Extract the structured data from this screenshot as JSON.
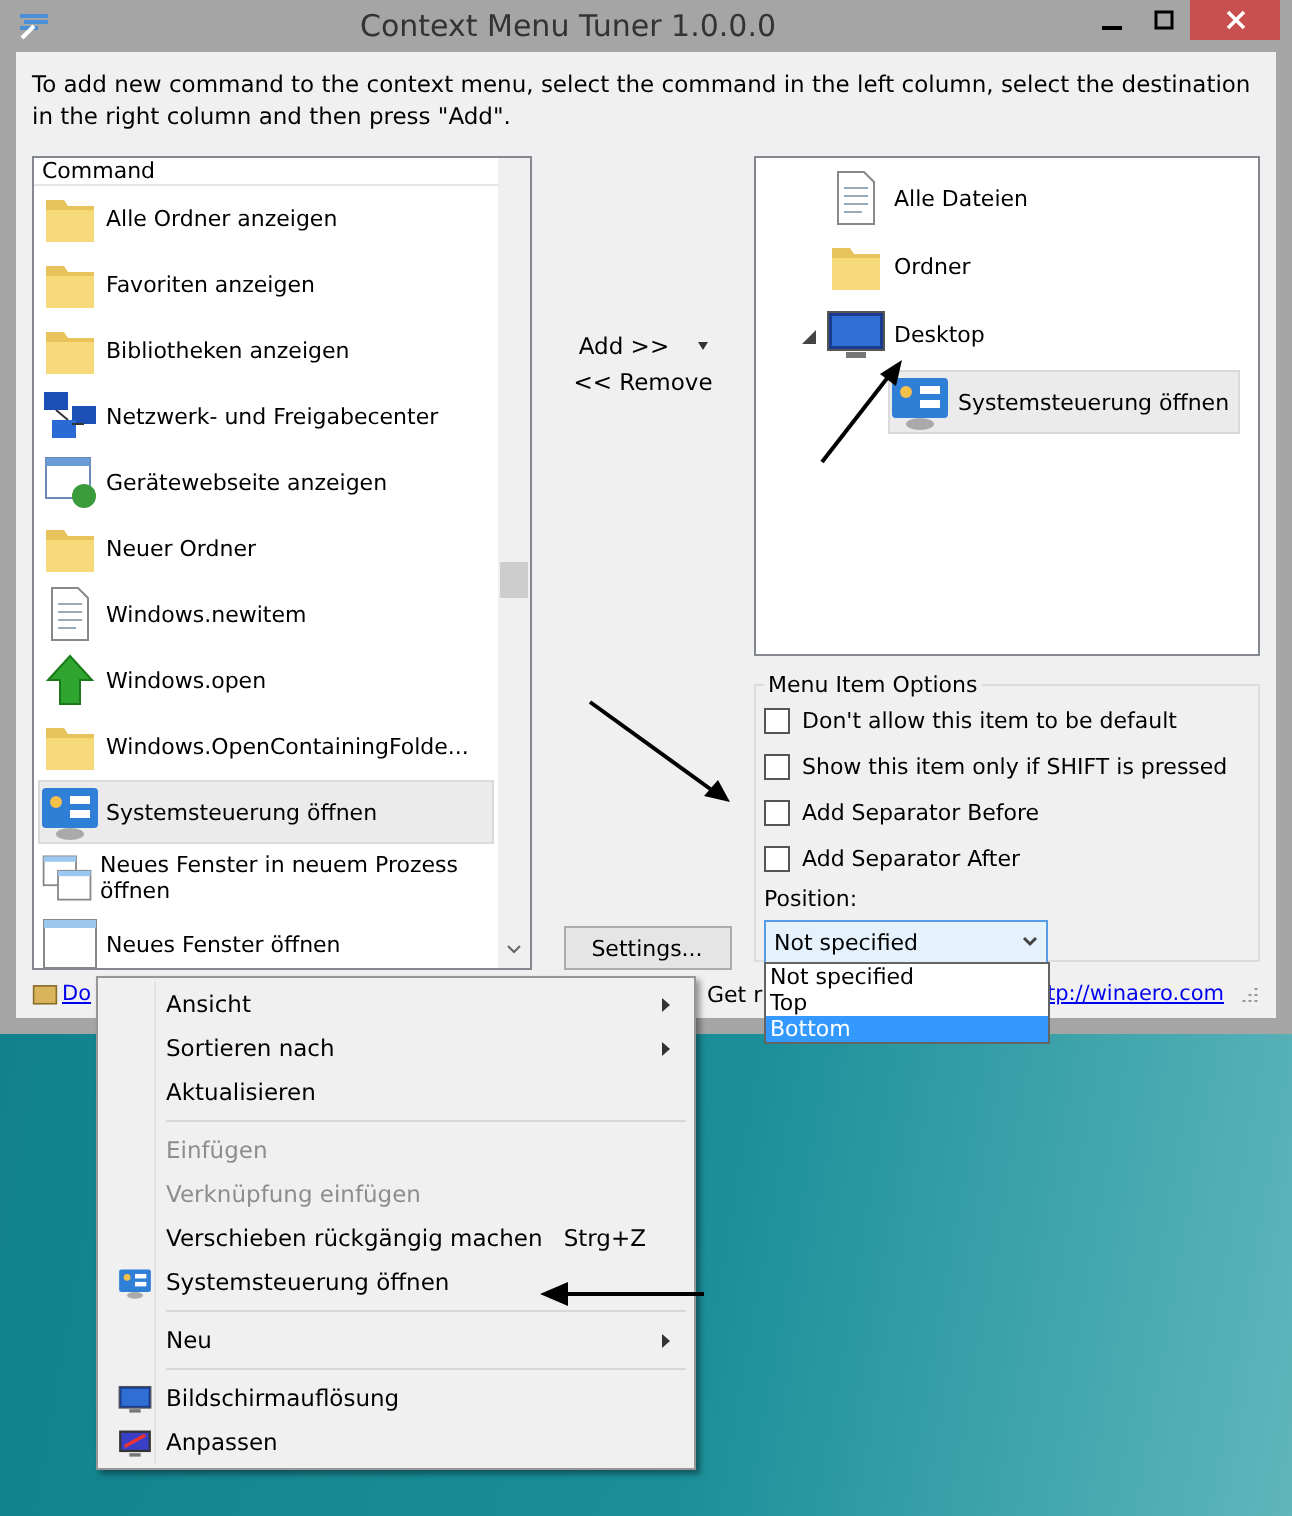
{
  "window": {
    "title": "Context Menu Tuner 1.0.0.0"
  },
  "description": "To add new command to the context menu, select the command in the left column, select the destination in the right column and then press \"Add\".",
  "command_list": {
    "header": "Command",
    "items": [
      {
        "label": "Alle Ordner anzeigen",
        "kind": "folder",
        "selected": false
      },
      {
        "label": "Favoriten anzeigen",
        "kind": "folder",
        "selected": false
      },
      {
        "label": "Bibliotheken anzeigen",
        "kind": "folder",
        "selected": false
      },
      {
        "label": "Netzwerk- und Freigabecenter",
        "kind": "network",
        "selected": false
      },
      {
        "label": "Gerätewebseite anzeigen",
        "kind": "webpage",
        "selected": false
      },
      {
        "label": "Neuer Ordner",
        "kind": "folder",
        "selected": false
      },
      {
        "label": "Windows.newitem",
        "kind": "document",
        "selected": false
      },
      {
        "label": "Windows.open",
        "kind": "arrow",
        "selected": false
      },
      {
        "label": "Windows.OpenContainingFolde...",
        "kind": "folder",
        "selected": false
      },
      {
        "label": "Systemsteuerung öffnen",
        "kind": "panel",
        "selected": true
      },
      {
        "label": "Neues Fenster in neuem Prozess öffnen",
        "kind": "windows",
        "selected": false
      },
      {
        "label": "Neues Fenster öffnen",
        "kind": "window",
        "selected": false
      }
    ]
  },
  "buttons": {
    "add": "Add >>",
    "remove": "<< Remove",
    "settings": "Settings..."
  },
  "tree": [
    {
      "label": "Alle Dateien",
      "kind": "document",
      "selected": false
    },
    {
      "label": "Ordner",
      "kind": "folder",
      "selected": false
    },
    {
      "label": "Desktop",
      "kind": "monitor",
      "selected": false,
      "expanded": true,
      "children": [
        {
          "label": "Systemsteuerung öffnen",
          "kind": "panel",
          "selected": true
        }
      ]
    }
  ],
  "options": {
    "title": "Menu Item Options",
    "checkboxes": [
      {
        "label": "Don't allow this item to be default",
        "checked": false
      },
      {
        "label": "Show this item only if SHIFT is pressed",
        "checked": false
      },
      {
        "label": "Add Separator Before",
        "checked": false
      },
      {
        "label": "Add Separator After",
        "checked": false
      }
    ],
    "position_label": "Position:",
    "position_value": "Not specified",
    "open": true,
    "position_options": [
      {
        "label": "Not specified",
        "selected": false
      },
      {
        "label": "Top",
        "selected": false
      },
      {
        "label": "Bottom",
        "selected": true
      }
    ]
  },
  "footer": {
    "link_left": "Do",
    "text": "Get r",
    "link_right": "tp://winaero.com"
  },
  "context_menu": [
    {
      "kind": "item",
      "label": "Ansicht",
      "submenu": true,
      "disabled": false
    },
    {
      "kind": "item",
      "label": "Sortieren nach",
      "submenu": true,
      "disabled": false
    },
    {
      "kind": "item",
      "label": "Aktualisieren",
      "submenu": false,
      "disabled": false
    },
    {
      "kind": "separator"
    },
    {
      "kind": "item",
      "label": "Einfügen",
      "submenu": false,
      "disabled": true
    },
    {
      "kind": "item",
      "label": "Verknüpfung einfügen",
      "submenu": false,
      "disabled": true
    },
    {
      "kind": "item",
      "label": "Verschieben rückgängig machen",
      "shortcut": "Strg+Z",
      "submenu": false,
      "disabled": false
    },
    {
      "kind": "panel",
      "label": "Systemsteuerung öffnen",
      "submenu": false,
      "disabled": false
    },
    {
      "kind": "separator"
    },
    {
      "kind": "item",
      "label": "Neu",
      "submenu": true,
      "disabled": false
    },
    {
      "kind": "separator"
    },
    {
      "kind": "monitor",
      "label": "Bildschirmauflösung",
      "submenu": false,
      "disabled": false
    },
    {
      "kind": "monitor2",
      "label": "Anpassen",
      "submenu": false,
      "disabled": false
    }
  ]
}
